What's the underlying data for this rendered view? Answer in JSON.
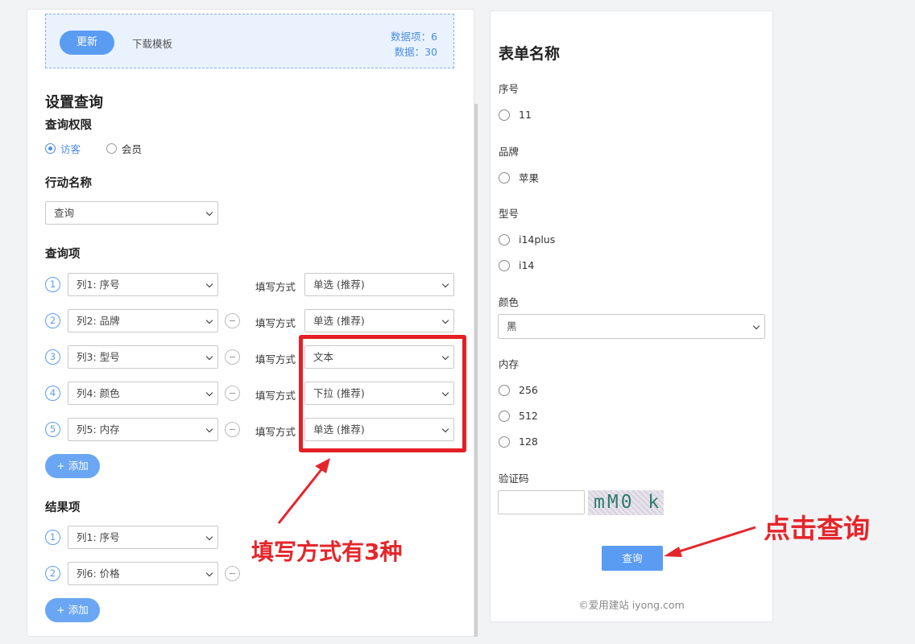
{
  "left": {
    "update_btn": "更新",
    "download_template": "下载模板",
    "stats_items": "数据项：6",
    "stats_rows": "数据：30",
    "setup_title": "设置查询",
    "permission_title": "查询权限",
    "permission_options": [
      "访客",
      "会员"
    ],
    "permission_selected": "访客",
    "action_title": "行动名称",
    "action_value": "查询",
    "query_items_title": "查询项",
    "mode_label": "填写方式",
    "query_items": [
      {
        "num": "1",
        "column": "列1: 序号",
        "mode": "单选 (推荐)"
      },
      {
        "num": "2",
        "column": "列2: 品牌",
        "mode": "单选 (推荐)"
      },
      {
        "num": "3",
        "column": "列3: 型号",
        "mode": "文本"
      },
      {
        "num": "4",
        "column": "列4: 颜色",
        "mode": "下拉 (推荐)"
      },
      {
        "num": "5",
        "column": "列5: 内存",
        "mode": "单选 (推荐)"
      }
    ],
    "add_btn": "+ 添加",
    "result_items_title": "结果项",
    "result_items": [
      {
        "num": "1",
        "column": "列1: 序号"
      },
      {
        "num": "2",
        "column": "列6: 价格"
      }
    ]
  },
  "annotations": {
    "modes_note": "填写方式有3种",
    "click_note": "点击查询",
    "color": "#e4262b"
  },
  "right": {
    "form_title": "表单名称",
    "fields": {
      "serial": {
        "label": "序号",
        "options": [
          "11"
        ]
      },
      "brand": {
        "label": "品牌",
        "options": [
          "苹果"
        ]
      },
      "model": {
        "label": "型号",
        "options": [
          "i14plus",
          "i14"
        ]
      },
      "color": {
        "label": "颜色",
        "value": "黑"
      },
      "memory": {
        "label": "内存",
        "options": [
          "256",
          "512",
          "128"
        ]
      },
      "captcha": {
        "label": "验证码",
        "image_text": "mM0 k"
      }
    },
    "query_btn": "查询",
    "footer": "©爱用建站 iyong.com"
  },
  "colors": {
    "accent": "#5b9cf3",
    "annotation_red": "#e41f25"
  }
}
